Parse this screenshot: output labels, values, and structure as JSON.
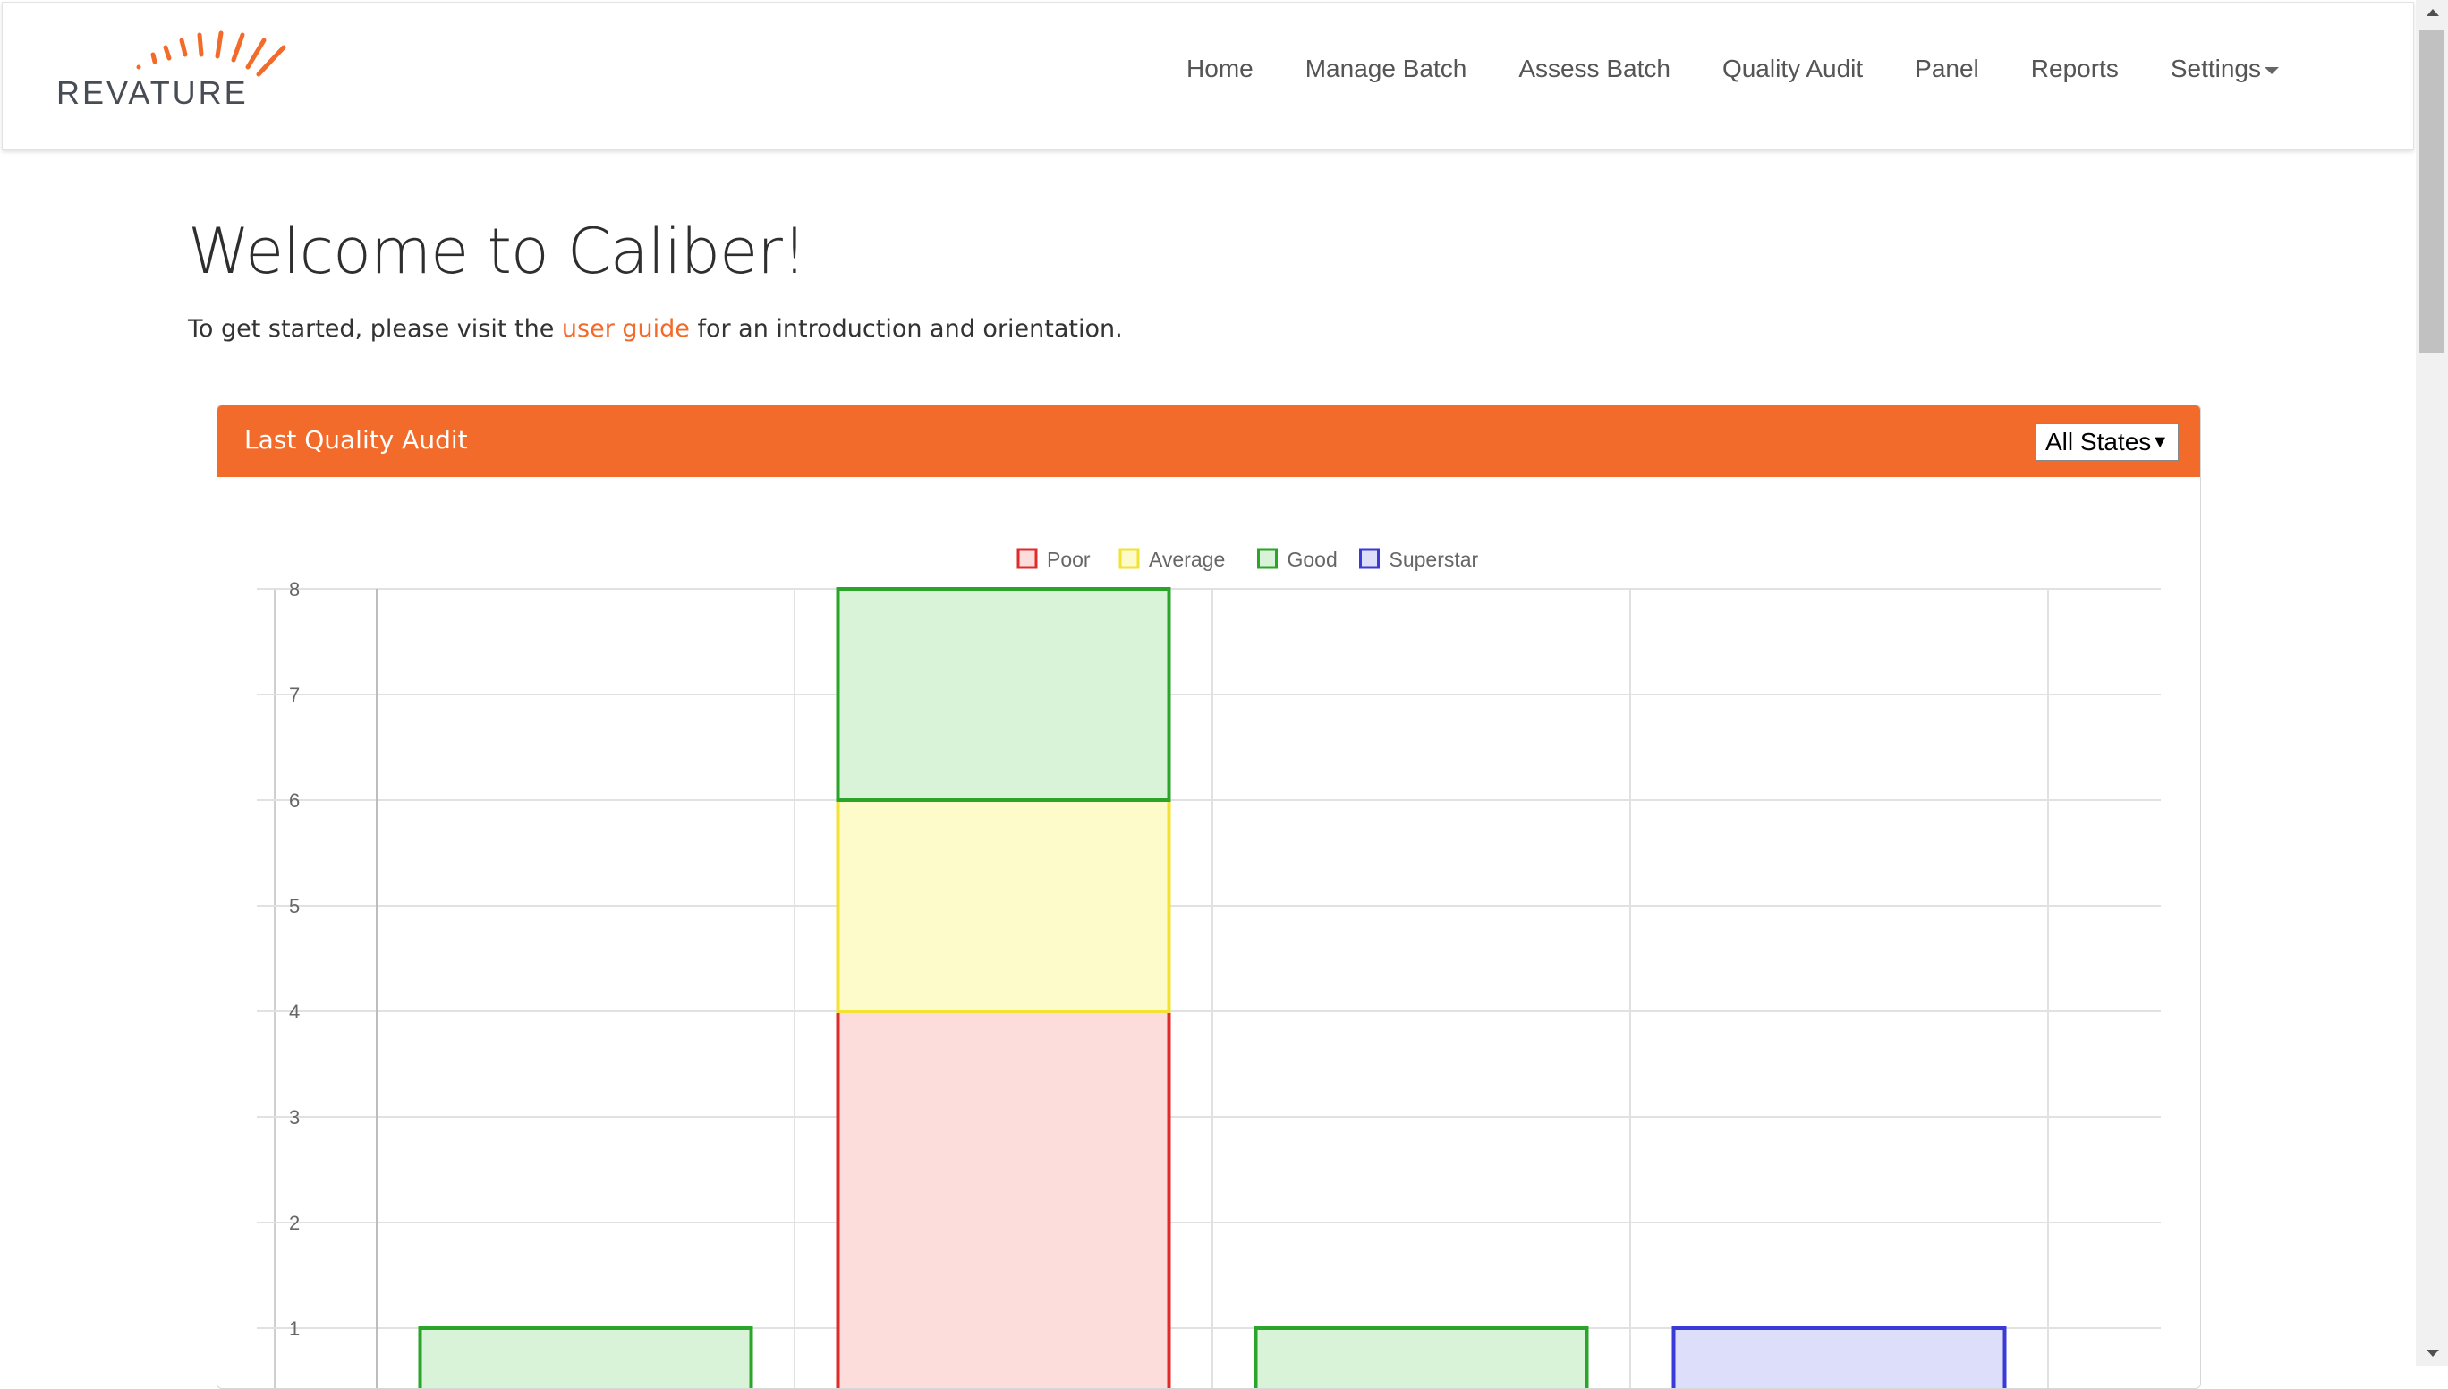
{
  "brand": {
    "logo_text": "REVATURE",
    "accent": "#f26b2b"
  },
  "nav": {
    "items": [
      "Home",
      "Manage Batch",
      "Assess Batch",
      "Quality Audit",
      "Panel",
      "Reports"
    ],
    "settings_label": "Settings"
  },
  "page": {
    "title": "Welcome to Caliber!",
    "intro_before": "To get started, please visit the ",
    "intro_link": "user guide",
    "intro_after": " for an introduction and orientation."
  },
  "panel": {
    "title": "Last Quality Audit",
    "state_filter": "All States",
    "header_color": "#f26b2b"
  },
  "chart_data": {
    "type": "bar",
    "stacked": true,
    "categories": [
      "",
      "",
      "",
      ""
    ],
    "series": [
      {
        "name": "Poor",
        "values": [
          0,
          4,
          0,
          0
        ],
        "stroke": "#e02b2b",
        "fill": "#fddcdc"
      },
      {
        "name": "Average",
        "values": [
          0,
          2,
          0,
          0
        ],
        "stroke": "#f2e233",
        "fill": "#fdfbc9"
      },
      {
        "name": "Good",
        "values": [
          1,
          2,
          1,
          0
        ],
        "stroke": "#2aa52a",
        "fill": "#d9f3d9"
      },
      {
        "name": "Superstar",
        "values": [
          0,
          0,
          0,
          1
        ],
        "stroke": "#3a3ad6",
        "fill": "#dddffa"
      }
    ],
    "ylim": [
      0,
      8
    ],
    "yticks": [
      1,
      2,
      3,
      4,
      5,
      6,
      7,
      8
    ],
    "grid": true,
    "legend_position": "top"
  }
}
